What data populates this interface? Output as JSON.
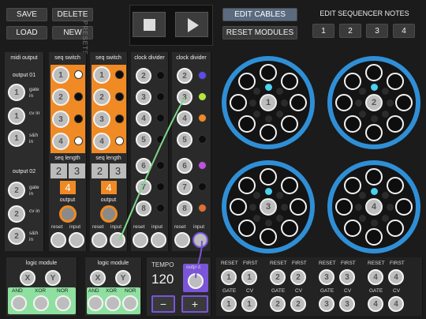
{
  "top": {
    "save": "SAVE",
    "delete": "DELETE",
    "load": "LOAD",
    "new": "NEW",
    "presets": "PRESETS",
    "edit_cables": "EDIT CABLES",
    "reset_modules": "RESET MODULES",
    "edit_seq_notes": "EDIT SEQUENCER NOTES",
    "notes": [
      "1",
      "2",
      "3",
      "4"
    ]
  },
  "midi": {
    "title": "midi output",
    "out1": "output 01",
    "out2": "output 02",
    "labels": [
      "gate in",
      "cv in",
      "s&h in"
    ],
    "jack1": "1",
    "jack2": "2"
  },
  "seq1": {
    "title": "seq switch",
    "jacks": [
      "1",
      "2",
      "3",
      "4"
    ],
    "length_label": "seq length",
    "length": [
      "2",
      "3"
    ],
    "value": "4",
    "output": "output",
    "reset": "reset",
    "input": "input"
  },
  "seq2": {
    "title": "seq switch",
    "jacks": [
      "1",
      "2",
      "3",
      "4"
    ],
    "length_label": "seq length",
    "length": [
      "2",
      "3"
    ],
    "value": "4",
    "output": "output",
    "reset": "reset",
    "input": "input"
  },
  "cd1": {
    "title": "clock divider",
    "jacks": [
      "2",
      "3",
      "4",
      "5",
      "6",
      "7",
      "8"
    ],
    "reset": "reset",
    "input": "input"
  },
  "cd2": {
    "title": "clock divider",
    "jacks": [
      "2",
      "3",
      "4",
      "5",
      "6",
      "7",
      "8"
    ],
    "reset": "reset",
    "input": "input",
    "led_colors": [
      "#5a4cf0",
      "#b6e83a",
      "#f08a24",
      "#1a1a1a",
      "#c050e0",
      "#1a1a1a",
      "#e07030"
    ]
  },
  "wheels": [
    "1",
    "2",
    "3",
    "4"
  ],
  "logic1": {
    "title": "logic module",
    "x": "X",
    "y": "Y",
    "and": "AND",
    "xor": "XOR",
    "nor": "NOR"
  },
  "logic2": {
    "title": "logic module",
    "x": "X",
    "y": "Y",
    "and": "AND",
    "xor": "XOR",
    "nor": "NOR"
  },
  "tempo": {
    "title": "TEMPO",
    "value": "120",
    "output": "output",
    "minus": "−",
    "plus": "+"
  },
  "seqio": {
    "reset": "RESET",
    "first": "FIRST",
    "gate": "GATE",
    "cv": "CV",
    "numbers": [
      "1",
      "2",
      "3",
      "4"
    ]
  },
  "colors": {
    "orange": "#f08a24",
    "blue": "#2f8fd6",
    "cyan": "#4ad0f0",
    "green": "#7fd88a",
    "purple": "#7a55d8"
  }
}
